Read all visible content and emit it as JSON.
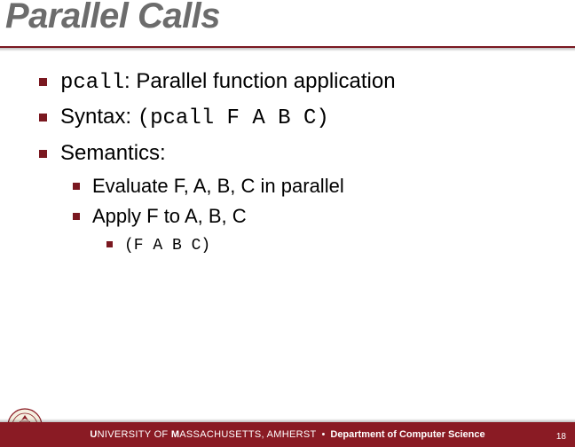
{
  "title": "Parallel Calls",
  "bullets": {
    "b1": {
      "code": "pcall",
      "rest": ": Parallel function application"
    },
    "b2": {
      "pre": "Syntax: ",
      "code": "(pcall F A B C)"
    },
    "b3": {
      "text": "Semantics:"
    },
    "sub": {
      "s1": "Evaluate F, A, B, C in parallel",
      "s2": "Apply F to A, B, C",
      "s2code": "(F A B C)"
    }
  },
  "footer": {
    "uni1": "U",
    "uni2": "NIVERSITY OF ",
    "uni3": "M",
    "uni4": "ASSACHUSETTS",
    "uni5": ", A",
    "uni6": "MHERST",
    "sep": "•",
    "dept": "Department of Computer Science"
  },
  "page": "18"
}
